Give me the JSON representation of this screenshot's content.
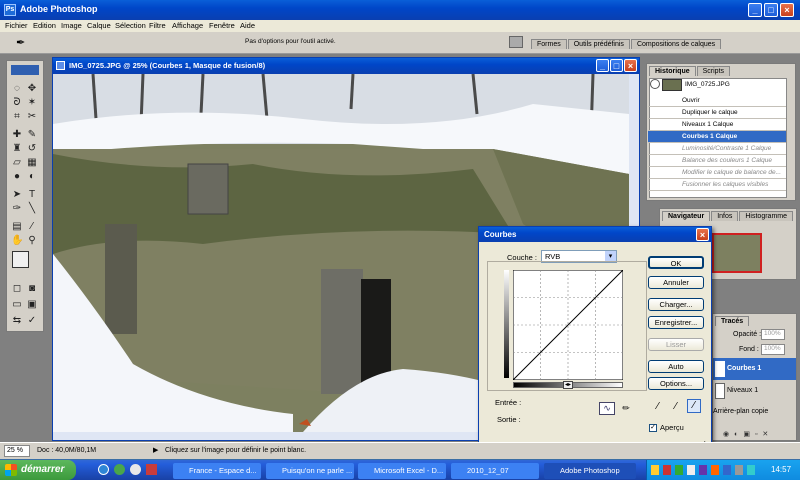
{
  "app": {
    "title": "Adobe Photoshop"
  },
  "menu": [
    "Fichier",
    "Edition",
    "Image",
    "Calque",
    "Sélection",
    "Filtre",
    "Affichage",
    "Fenêtre",
    "Aide"
  ],
  "options": {
    "hint": "Pas d'options pour l'outil activé.",
    "tabs": [
      "Formes",
      "Outils prédéfinis",
      "Compositions de calques"
    ]
  },
  "document": {
    "title": "IMG_0725.JPG @ 25% (Courbes 1, Masque de fusion/8)"
  },
  "history": {
    "tabs": [
      "Historique",
      "Scripts"
    ],
    "snapshot": "IMG_0725.JPG",
    "items": [
      "Ouvrir",
      "Dupliquer le calque",
      "Niveaux 1 Calque",
      "Courbes 1 Calque",
      "Luminosité/Contraste 1 Calque",
      "Balance des couleurs 1 Calque",
      "Modifier le calque de balance de...",
      "Fusionner les calques visibles"
    ],
    "active": 3
  },
  "navigator": {
    "tabs": [
      "Navigateur",
      "Infos",
      "Histogramme"
    ]
  },
  "layers": {
    "tab": "Tracés",
    "opacity_label": "Opacité :",
    "opacity": "100%",
    "fill_label": "Fond :",
    "fill": "100%",
    "items": [
      "Courbes 1",
      "Niveaux 1",
      "Arrière-plan copie"
    ]
  },
  "curves": {
    "title": "Courbes",
    "channel_label": "Couche :",
    "channel": "RVB",
    "input_label": "Entrée :",
    "output_label": "Sortie :",
    "buttons": [
      "OK",
      "Annuler",
      "Charger...",
      "Enregistrer...",
      "Lisser",
      "Auto",
      "Options..."
    ],
    "preview_label": "Aperçu"
  },
  "status": {
    "zoom": "25 %",
    "doc": "Doc : 40,0M/80,1M",
    "hint": "Cliquez sur l'image pour définir le point blanc."
  },
  "taskbar": {
    "start": "démarrer",
    "tasks": [
      "France - Espace d...",
      "Puisqu'on ne parle ...",
      "Microsoft Excel - D...",
      "2010_12_07",
      "Adobe Photoshop"
    ],
    "clock": "14:57"
  },
  "colors": {
    "xp_blue": "#0a50c8",
    "taskbar": "#245edb",
    "start": "#3c9a3c",
    "highlight": "#316ac5"
  }
}
